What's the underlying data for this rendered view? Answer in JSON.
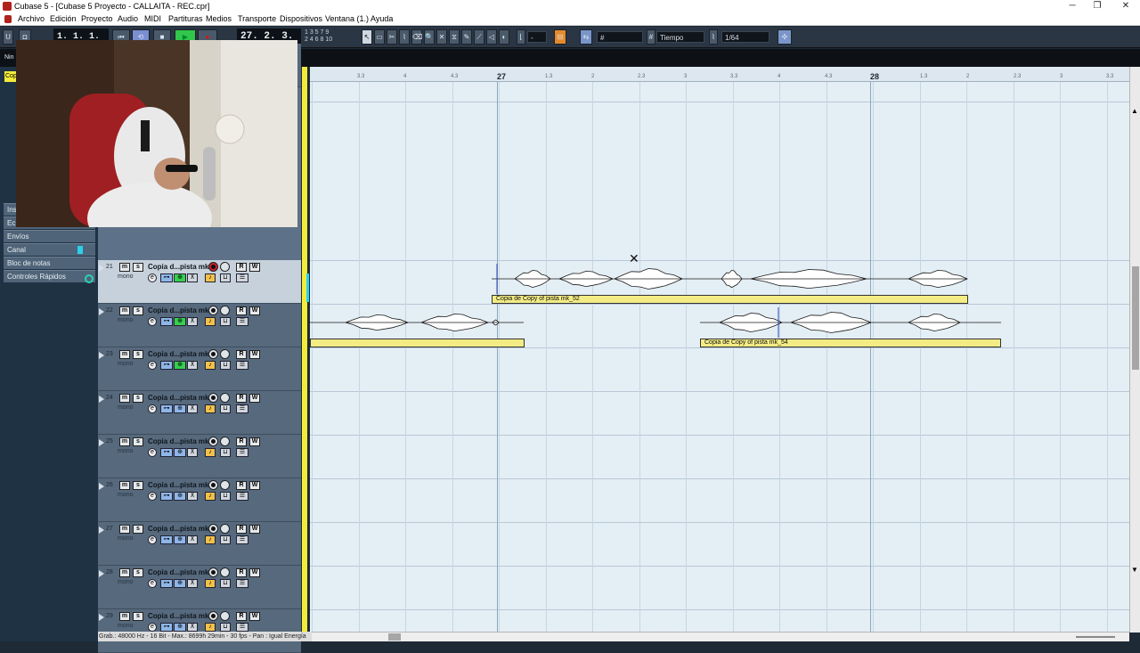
{
  "window": {
    "title": "Cubase 5 - [Cubase 5 Proyecto - CALLAITA - REC.cpr]",
    "minimize": "─",
    "maximize": "❐",
    "close": "✕"
  },
  "menu": [
    "Archivo",
    "Edición",
    "Proyecto",
    "Audio",
    "MIDI",
    "Partituras",
    "Medios",
    "Transporte",
    "Dispositivos",
    "Ventana (1.)",
    "Ayuda"
  ],
  "toolbar": {
    "left_locator": "1. 1. 1.   0",
    "position": "27. 2. 3. 83",
    "numbers_row1": "1 3 5 7 9",
    "numbers_row2": "2 4 6 8 10",
    "nudge_value": "-",
    "grid_type": "Tiempo",
    "quantize": "1/64"
  },
  "inspector": {
    "rows": [
      "Ins",
      "Ec",
      "Envíos",
      "Canal",
      "Bloc de notas",
      "Controles Rápidos"
    ],
    "side_labels": [
      "Nin",
      "Cop"
    ]
  },
  "tracks": [
    {
      "number": "",
      "name": "",
      "mono": "mono",
      "selected": false
    },
    {
      "number": "21",
      "name": "Copia d...pista mk",
      "mono": "mono",
      "selected": true
    },
    {
      "number": "22",
      "name": "Copia d...pista mk",
      "mono": "mono",
      "selected": false
    },
    {
      "number": "23",
      "name": "Copia d...pista mk",
      "mono": "mono",
      "selected": false
    },
    {
      "number": "24",
      "name": "Copia d...pista mk",
      "mono": "mono",
      "selected": false
    },
    {
      "number": "25",
      "name": "Copia d...pista mk",
      "mono": "mono",
      "selected": false
    },
    {
      "number": "26",
      "name": "Copia d...pista mk",
      "mono": "mono",
      "selected": false
    },
    {
      "number": "27",
      "name": "Copia d...pista mk",
      "mono": "mono",
      "selected": false
    },
    {
      "number": "28",
      "name": "Copia d...pista mk",
      "mono": "mono",
      "selected": false
    },
    {
      "number": "29",
      "name": "Copia d...pista mk",
      "mono": "mono",
      "selected": false
    }
  ],
  "track_buttons": {
    "mute": "m",
    "solo": "s",
    "read": "R",
    "write": "W",
    "edit": "e"
  },
  "ruler": {
    "bars": [
      "27",
      "28"
    ],
    "sub_ticks": [
      "3.3",
      "4",
      "4.3",
      "1.3",
      "2",
      "2.3",
      "3",
      "3.3",
      "4",
      "4.3",
      "1.3",
      "2",
      "2.3",
      "3",
      "3.3"
    ]
  },
  "events": [
    {
      "label": "Copia de Copy of pista mk_52"
    },
    {
      "label": ""
    },
    {
      "label": "Copia de Copy of pista mk_54"
    }
  ],
  "status": "Grab.: 48000 Hz - 16 Bit - Max.: 8699h 29min - 30 fps - Pan : Igual Energía",
  "colors": {
    "event_fill": "#f3ec85",
    "arrange_bg": "#e4eef5",
    "track_selected": "#c6d1dc",
    "record_red": "#c8202a"
  },
  "icons": [
    "pointer-icon",
    "range-icon",
    "split-icon",
    "glue-icon",
    "erase-icon",
    "zoom-icon",
    "mute-tool-icon",
    "time-warp-icon",
    "draw-icon",
    "line-icon",
    "play-tool-icon",
    "scrub-icon"
  ]
}
